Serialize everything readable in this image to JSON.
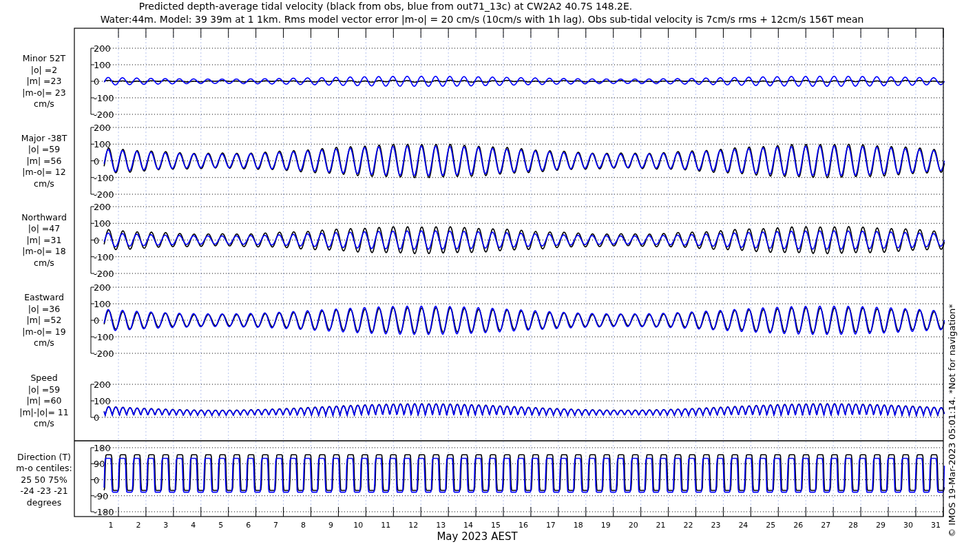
{
  "title_lines": [
    "Predicted depth-average tidal velocity (black from obs, blue from out71_13c) at CW2A2 40.7S 148.2E.",
    "Water:44m. Model: 39 39m at 1 1km. Rms model vector error |m-o| = 20 cm/s (10cm/s with 1h lag). Obs sub-tidal velocity is 7cm/s rms + 12cm/s 156T mean"
  ],
  "traces": [
    {
      "color": "#000000"
    },
    {
      "color": "#0000ff"
    }
  ],
  "panels": [
    {
      "kind": "minor",
      "label": [
        "Minor 52T",
        "|o| =2",
        "|m| =23",
        "|m-o|= 23",
        "cm/s"
      ],
      "yticks": [
        "200",
        "100",
        "0",
        "-100",
        "-200"
      ]
    },
    {
      "kind": "major",
      "label": [
        "Major -38T",
        "|o| =59",
        "|m| =56",
        "|m-o|= 12",
        "cm/s"
      ],
      "yticks": [
        "200",
        "100",
        "0",
        "-100",
        "-200"
      ]
    },
    {
      "kind": "north",
      "label": [
        "Northward",
        "|o| =47",
        "|m| =31",
        "|m-o|= 18",
        "cm/s"
      ],
      "yticks": [
        "200",
        "100",
        "0",
        "-100",
        "-200"
      ]
    },
    {
      "kind": "east",
      "label": [
        "Eastward",
        "|o| =36",
        "|m| =52",
        "|m-o|= 19",
        "cm/s"
      ],
      "yticks": [
        "200",
        "100",
        "0",
        "-100",
        "-200"
      ]
    },
    {
      "kind": "speed",
      "label": [
        "Speed",
        "|o| =59",
        "|m| =60",
        "|m|-|o|= 11",
        "cm/s"
      ],
      "yticks": [
        "200",
        "100",
        "0"
      ]
    },
    {
      "kind": "direction",
      "label": [
        "Direction (T)",
        "m-o centiles:",
        "25  50  75%",
        "-24 -23 -21",
        "degrees"
      ],
      "yticks": [
        "180",
        "90",
        "0",
        "-90",
        "-180"
      ]
    }
  ],
  "xtick_labels": [
    "1",
    "2",
    "3",
    "4",
    "5",
    "6",
    "7",
    "8",
    "9",
    "10",
    "11",
    "12",
    "13",
    "14",
    "15",
    "16",
    "17",
    "18",
    "19",
    "20",
    "21",
    "22",
    "23",
    "24",
    "25",
    "26",
    "27",
    "28",
    "29",
    "30",
    "31"
  ],
  "xlabel": "May 2023 AEST",
  "stamp": "© IMOS 19-Mar-2023 05:01:14. *Not for navigation*"
}
